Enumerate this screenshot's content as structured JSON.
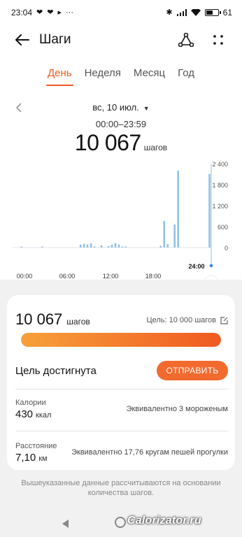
{
  "status": {
    "time": "23:04",
    "icons_left": [
      "heart-icon",
      "heart-icon",
      "play-icon",
      "more-dots-icon"
    ],
    "battery": "61",
    "battery_level": 0.61
  },
  "appbar": {
    "title": "Шаги"
  },
  "tabs": [
    {
      "label": "День",
      "active": true
    },
    {
      "label": "Неделя",
      "active": false
    },
    {
      "label": "Месяц",
      "active": false
    },
    {
      "label": "Год",
      "active": false
    }
  ],
  "date": {
    "label": "вс, 10 июл.",
    "range": "00:00–23:59"
  },
  "total": {
    "value": "10 067",
    "unit": "шагов"
  },
  "chart_data": {
    "type": "bar",
    "x_ticks": [
      "00:00",
      "06:00",
      "12:00",
      "18:00",
      "24:00"
    ],
    "y_ticks": [
      "2 400",
      "1 800",
      "1 200",
      "600",
      "0"
    ],
    "ylim": [
      0,
      2400
    ],
    "bar_color": "#8cc0e8",
    "values": [
      0,
      10,
      0,
      0,
      0,
      0,
      0,
      0,
      0,
      0,
      0,
      0,
      0,
      0,
      0,
      0,
      0,
      0,
      0,
      0,
      0,
      0,
      0,
      0,
      0,
      0,
      0,
      0,
      0,
      0,
      0,
      0,
      0,
      10,
      0,
      0,
      0,
      0,
      0,
      0,
      0,
      0,
      0,
      0,
      0,
      0,
      0,
      0,
      0,
      0,
      0,
      0,
      0,
      0,
      0,
      0,
      0,
      0,
      0,
      0,
      0,
      0,
      0,
      0,
      0,
      0,
      0,
      0,
      0,
      0,
      0,
      0,
      0,
      0,
      0,
      0,
      0,
      0,
      0,
      0,
      0,
      0,
      0,
      0,
      0,
      0,
      0,
      0,
      0,
      0,
      0,
      0,
      0,
      0,
      0,
      0,
      0,
      0,
      0,
      0,
      0,
      0,
      0,
      0,
      0,
      0,
      0,
      0,
      0,
      0,
      0,
      0,
      0,
      0,
      0,
      0,
      0,
      0,
      0,
      0,
      0,
      0,
      0,
      0,
      0,
      0,
      0,
      0,
      0,
      0,
      0,
      0,
      0,
      0,
      0,
      0,
      0,
      0,
      0,
      0,
      0,
      0,
      0,
      0,
      0,
      0,
      0,
      0,
      0,
      0,
      0,
      0,
      0,
      0,
      0,
      0,
      0,
      0,
      0,
      0,
      0,
      0,
      0,
      0,
      0,
      0,
      0,
      0,
      0,
      0,
      0,
      0,
      0,
      0,
      0,
      0,
      0,
      0,
      0,
      0,
      0,
      0,
      0,
      0,
      0,
      0,
      0,
      0,
      0,
      0,
      0,
      0,
      0,
      0,
      0,
      0,
      0,
      0,
      0,
      0,
      0,
      0,
      0,
      0,
      0,
      0,
      0,
      0,
      0,
      0,
      0,
      0,
      0,
      0,
      0,
      0,
      0,
      0,
      0,
      0,
      0,
      0,
      0,
      0,
      0,
      0,
      0,
      0,
      0,
      0,
      0,
      0,
      0,
      0,
      0,
      0,
      0,
      0,
      0,
      0,
      0,
      0,
      0,
      0,
      0,
      0,
      0,
      0,
      0,
      0,
      0,
      0,
      0,
      0,
      0,
      0,
      0,
      0,
      0,
      0,
      0,
      0,
      0,
      0,
      0,
      0,
      0,
      0,
      0,
      0,
      0,
      0,
      0,
      0,
      0,
      0,
      0,
      0,
      0,
      0,
      0,
      0,
      0,
      0,
      0,
      0,
      0,
      0
    ],
    "bars": [
      {
        "slot": 2,
        "value": 20
      },
      {
        "slot": 8,
        "value": 20
      },
      {
        "slot": 19,
        "value": 80
      },
      {
        "slot": 20,
        "value": 110
      },
      {
        "slot": 21,
        "value": 90
      },
      {
        "slot": 22,
        "value": 120
      },
      {
        "slot": 23,
        "value": 30
      },
      {
        "slot": 25,
        "value": 60
      },
      {
        "slot": 27,
        "value": 40
      },
      {
        "slot": 28,
        "value": 80
      },
      {
        "slot": 29,
        "value": 120
      },
      {
        "slot": 30,
        "value": 90
      },
      {
        "slot": 31,
        "value": 30
      },
      {
        "slot": 32,
        "value": 20
      },
      {
        "slot": 42,
        "value": 50
      },
      {
        "slot": 43,
        "value": 760
      },
      {
        "slot": 44,
        "value": 100
      },
      {
        "slot": 46,
        "value": 660
      },
      {
        "slot": 47,
        "value": 2200
      },
      {
        "slot": 56,
        "value": 2100
      }
    ],
    "slots": 57,
    "cursor_label": "24:00"
  },
  "summary": {
    "steps": "10 067",
    "steps_unit": "шагов",
    "goal": "Цель: 10 000 шагов",
    "progress": 1.0,
    "goal_done": "Цель достигнута",
    "send": "ОТПРАВИТЬ",
    "calories_label": "Калории",
    "calories_value": "430",
    "calories_unit": "ккал",
    "calories_equiv": "Эквивалентно 3 мороженым",
    "distance_label": "Расстояние",
    "distance_value": "7,10",
    "distance_unit": "км",
    "distance_equiv": "Эквивалентно 17,76 кругам пешей прогулки"
  },
  "footnote": "Вышеуказанные данные рассчитываются на основании количества шагов.",
  "watermark": "Calorizator.ru",
  "colors": {
    "accent": "#f05a22",
    "bar": "#8cc0e8"
  }
}
